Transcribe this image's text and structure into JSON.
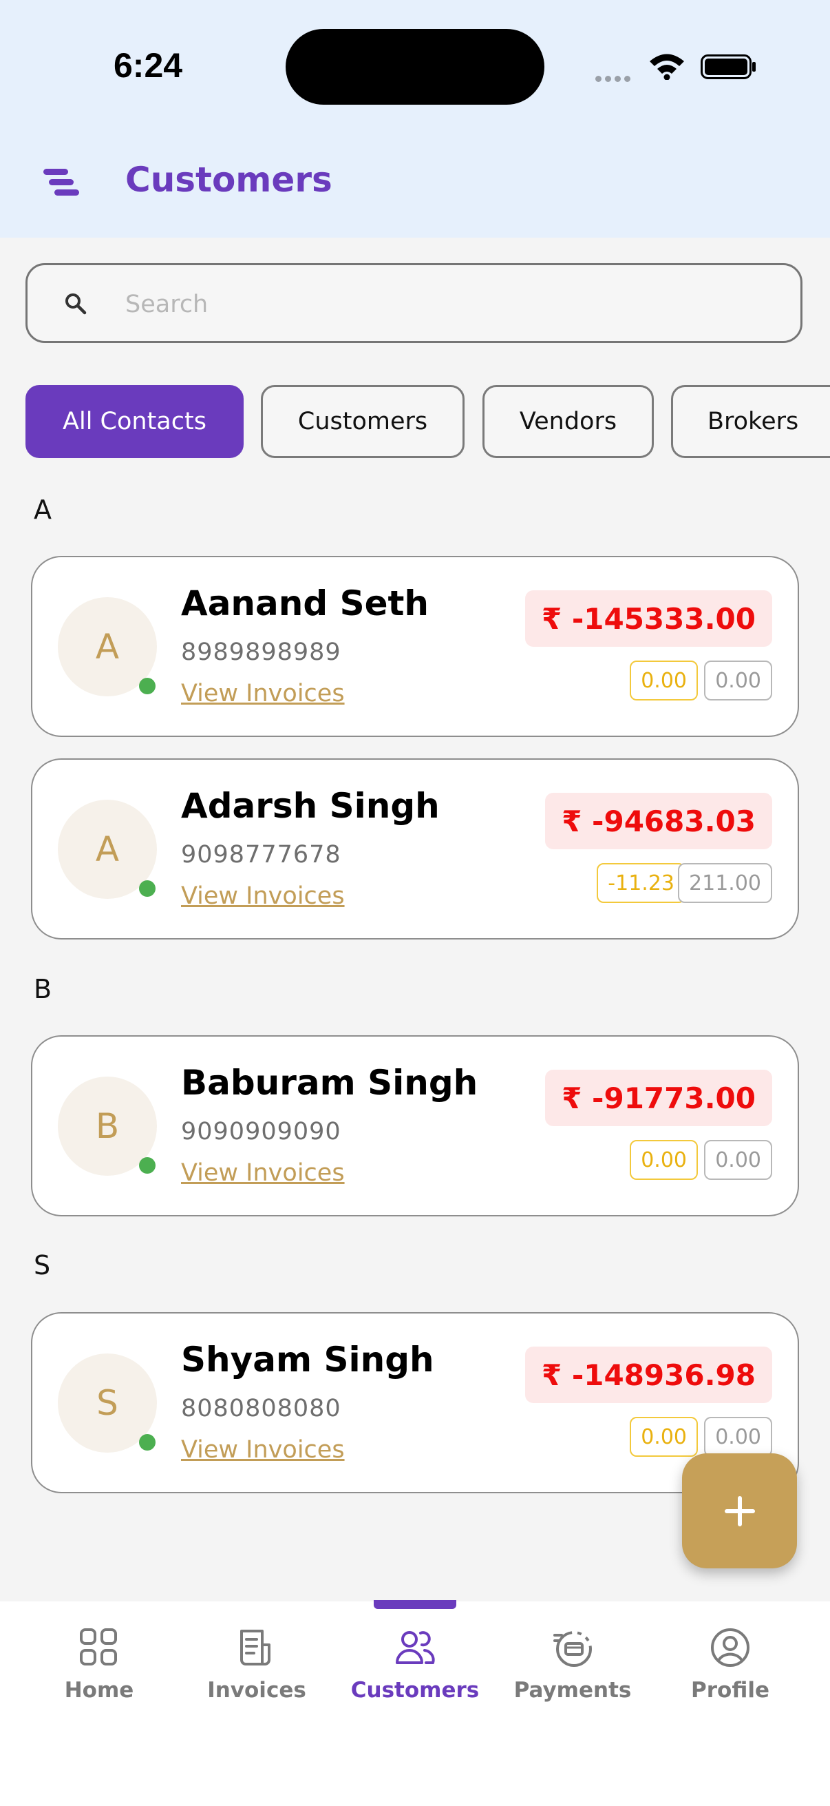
{
  "status_bar": {
    "time": "6:24"
  },
  "header": {
    "title": "Customers"
  },
  "search": {
    "placeholder": "Search"
  },
  "filters": [
    {
      "label": "All Contacts",
      "active": true
    },
    {
      "label": "Customers",
      "active": false
    },
    {
      "label": "Vendors",
      "active": false
    },
    {
      "label": "Brokers",
      "active": false
    }
  ],
  "sections": [
    {
      "letter": "A"
    },
    {
      "letter": "B"
    },
    {
      "letter": "S"
    }
  ],
  "contacts": [
    {
      "initial": "A",
      "name": "Aanand Seth",
      "phone": "8989898989",
      "link": "View Invoices",
      "balance": "₹ -145333.00",
      "pill1": "0.00",
      "pill2": "0.00"
    },
    {
      "initial": "A",
      "name": "Adarsh Singh",
      "phone": "9098777678",
      "link": "View Invoices",
      "balance": "₹ -94683.03",
      "pill1": "-11.23",
      "pill2": "211.00"
    },
    {
      "initial": "B",
      "name": "Baburam Singh",
      "phone": "9090909090",
      "link": "View Invoices",
      "balance": "₹ -91773.00",
      "pill1": "0.00",
      "pill2": "0.00"
    },
    {
      "initial": "S",
      "name": "Shyam Singh",
      "phone": "8080808080",
      "link": "View Invoices",
      "balance": "₹ -148936.98",
      "pill1": "0.00",
      "pill2": "0.00"
    }
  ],
  "bottom_nav": [
    {
      "label": "Home",
      "icon": "home-grid-icon",
      "active": false
    },
    {
      "label": "Invoices",
      "icon": "invoice-icon",
      "active": false
    },
    {
      "label": "Customers",
      "icon": "users-icon",
      "active": true
    },
    {
      "label": "Payments",
      "icon": "payments-icon",
      "active": false
    },
    {
      "label": "Profile",
      "icon": "profile-icon",
      "active": false
    }
  ],
  "colors": {
    "accent": "#6a3bbd",
    "gold": "#c6a058",
    "negative": "#ee0c0c",
    "online": "#4caf50"
  }
}
